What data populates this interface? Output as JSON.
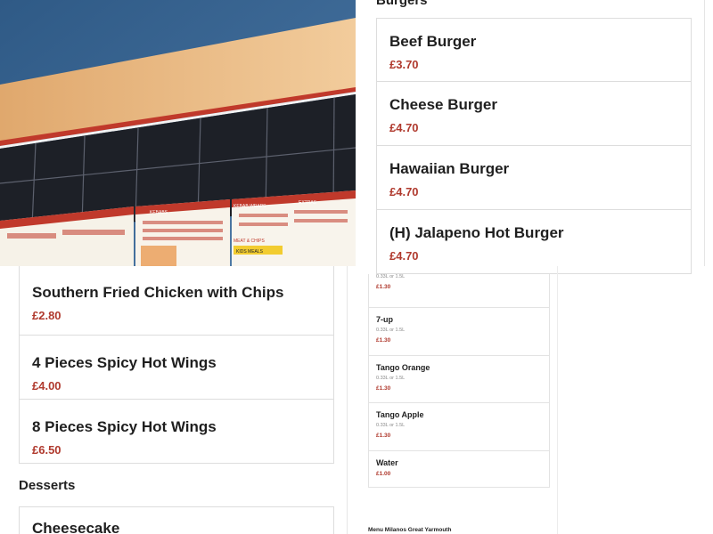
{
  "burgers": {
    "section_title": "Burgers",
    "items": [
      {
        "name": "Beef Burger",
        "price": "£3.70"
      },
      {
        "name": "Cheese Burger",
        "price": "£4.70"
      },
      {
        "name": "Hawaiian Burger",
        "price": "£4.70"
      },
      {
        "name": "(H) Jalapeno Hot Burger",
        "price": "£4.70"
      }
    ]
  },
  "chicken": {
    "items": [
      {
        "name": "Southern Fried Chicken with Chips",
        "price": "£2.80"
      },
      {
        "name": "4 Pieces Spicy Hot Wings",
        "price": "£4.00"
      },
      {
        "name": "8 Pieces Spicy Hot Wings",
        "price": "£6.50"
      }
    ]
  },
  "desserts": {
    "section_title": "Desserts",
    "items": [
      {
        "name": "Cheesecake"
      }
    ]
  },
  "drinks": {
    "items": [
      {
        "name": "",
        "size": "0.33L or 1.5L",
        "price": "£1.30"
      },
      {
        "name": "7-up",
        "size": "0.33L or 1.5L",
        "price": "£1.30"
      },
      {
        "name": "Tango Orange",
        "size": "0.33L or 1.5L",
        "price": "£1.30"
      },
      {
        "name": "Tango Apple",
        "size": "0.33L or 1.5L",
        "price": "£1.30"
      },
      {
        "name": "Water",
        "size": "",
        "price": "£1.00"
      }
    ]
  },
  "footer": {
    "link_text": "Menu Milanos Great Yarmouth"
  },
  "photo": {
    "menu_boards": [
      "KEBABS",
      "KEBAB WRAPS",
      "EXTRAS",
      "MEAT & CHIPS",
      "KIDS MEALS"
    ]
  },
  "colors": {
    "price": "#b03a2e",
    "border": "#dddddd"
  }
}
